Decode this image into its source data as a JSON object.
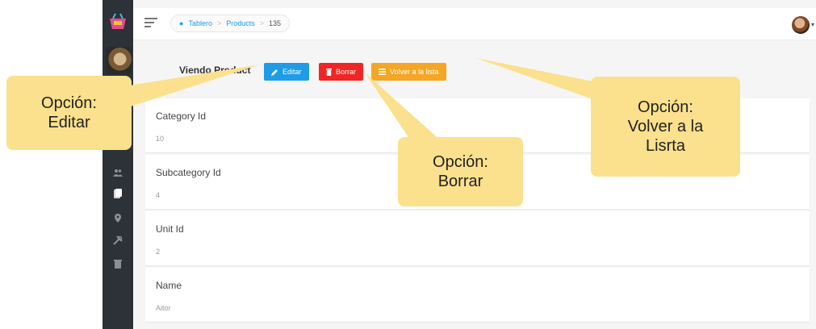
{
  "breadcrumb": {
    "home": "Tablero",
    "section": "Products",
    "current": "135"
  },
  "page": {
    "title": "Viendo Product",
    "buttons": {
      "edit": "Editar",
      "delete": "Borrar",
      "back": "Volver a la lista"
    }
  },
  "fields": [
    {
      "label": "Category Id",
      "value": "10"
    },
    {
      "label": "Subcategory Id",
      "value": "4"
    },
    {
      "label": "Unit Id",
      "value": "2"
    },
    {
      "label": "Name",
      "value": "Aitor"
    }
  ],
  "callouts": {
    "edit": [
      "Opción:",
      "Editar"
    ],
    "delete": [
      "Opción:",
      "Borrar"
    ],
    "back": [
      "Opción:",
      "Volver a la",
      "Lisrta"
    ]
  },
  "colors": {
    "sidebar": "#2d3238",
    "primary": "#1e9ce8",
    "danger": "#f02626",
    "warning": "#f5a623",
    "callout": "#fbe08d"
  }
}
